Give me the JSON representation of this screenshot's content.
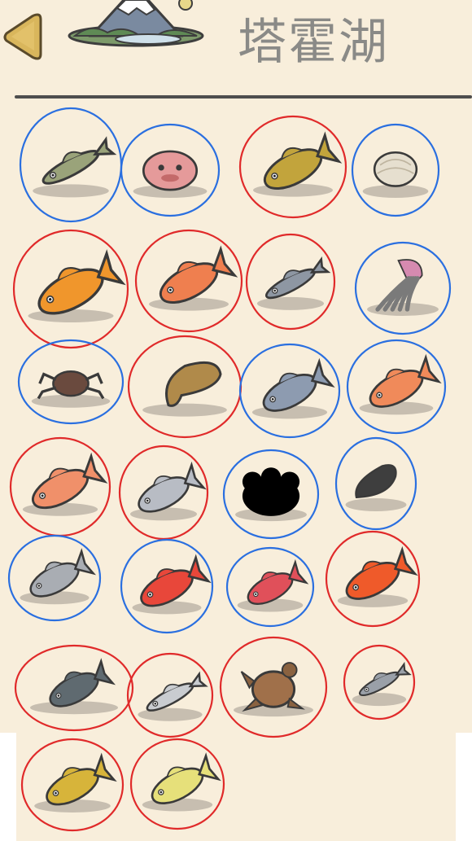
{
  "header": {
    "title": "塔霍湖",
    "back_icon": "chevron-left-icon",
    "location_icon": "mountain-lake-icon"
  },
  "colors": {
    "background": "#f8eedb",
    "title_text": "#8a8a87",
    "divider": "#4e4e4e",
    "circle_red": "#e02a2a",
    "circle_blue": "#2a6fe0",
    "back_button": "#d9b65c"
  },
  "collection": {
    "items": [
      {
        "icon": "trout-icon",
        "circle": "blue",
        "body": "#9aa37a",
        "discovered": true
      },
      {
        "icon": "blobfish-icon",
        "circle": "blue",
        "body": "#e59a9a",
        "discovered": true
      },
      {
        "icon": "carp-icon",
        "circle": "red",
        "body": "#c2a43c",
        "discovered": true
      },
      {
        "icon": "clam-icon",
        "circle": "blue",
        "body": "#e6dfcf",
        "discovered": true
      },
      {
        "icon": "goldfish-icon",
        "circle": "red",
        "body": "#f0962c",
        "discovered": true
      },
      {
        "icon": "red-snapper-icon",
        "circle": "red",
        "body": "#ef7f4f",
        "discovered": true
      },
      {
        "icon": "sardine-icon",
        "circle": "red",
        "body": "#8e97a3",
        "discovered": true
      },
      {
        "icon": "jellyfish-icon",
        "circle": "blue",
        "body": "#7a7a7a",
        "discovered": true
      },
      {
        "icon": "crab-icon",
        "circle": "blue",
        "body": "#6a4a3e",
        "discovered": true
      },
      {
        "icon": "cuttlefish-icon",
        "circle": "red",
        "body": "#b08a4a",
        "discovered": true
      },
      {
        "icon": "yellowtail-icon",
        "circle": "blue",
        "body": "#8d9bb0",
        "discovered": true
      },
      {
        "icon": "koi-icon",
        "circle": "blue",
        "body": "#f08a5a",
        "discovered": true
      },
      {
        "icon": "sea-bream-icon",
        "circle": "red",
        "body": "#f0906a",
        "discovered": true
      },
      {
        "icon": "silver-fish-icon",
        "circle": "red",
        "body": "#b8bcc4",
        "discovered": true
      },
      {
        "icon": "unknown-silhouette-icon",
        "circle": "blue",
        "body": "#000000",
        "discovered": false
      },
      {
        "icon": "mussel-icon",
        "circle": "blue",
        "body": "#3e3e3e",
        "discovered": true
      },
      {
        "icon": "pomfret-icon",
        "circle": "blue",
        "body": "#a9adb3",
        "discovered": true
      },
      {
        "icon": "red-grouper-icon",
        "circle": "blue",
        "body": "#e8473a",
        "discovered": true
      },
      {
        "icon": "red-rockfish-icon",
        "circle": "blue",
        "body": "#e0505a",
        "discovered": true
      },
      {
        "icon": "orange-rockfish-icon",
        "circle": "red",
        "body": "#ef5a2a",
        "discovered": true
      },
      {
        "icon": "tilapia-icon",
        "circle": "red",
        "body": "#5f6a70",
        "discovered": true
      },
      {
        "icon": "needlefish-icon",
        "circle": "red",
        "body": "#c9ccd0",
        "discovered": true
      },
      {
        "icon": "sea-turtle-icon",
        "circle": "red",
        "body": "#a0704a",
        "discovered": true
      },
      {
        "icon": "small-minnow-icon",
        "circle": "red",
        "body": "#9aa0a8",
        "discovered": true
      },
      {
        "icon": "yellow-perch-icon",
        "circle": "red",
        "body": "#d7b43a",
        "discovered": true
      },
      {
        "icon": "yellow-fin-fish-icon",
        "circle": "red",
        "body": "#e6e07a",
        "discovered": true
      }
    ]
  }
}
